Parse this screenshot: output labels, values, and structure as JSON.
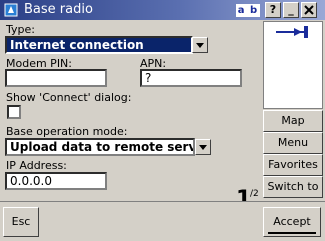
{
  "window": {
    "title": "Base radio",
    "input_mode": "a b",
    "help_label": "?",
    "minimize_label": "_",
    "close_label": "X"
  },
  "form": {
    "type_label": "Type:",
    "type_value": "Internet connection",
    "modem_pin_label": "Modem PIN:",
    "modem_pin_value": "",
    "apn_label": "APN:",
    "apn_value": "?",
    "show_connect_label": "Show 'Connect' dialog:",
    "show_connect_checked": false,
    "base_mode_label": "Base operation mode:",
    "base_mode_value": "Upload data to remote server",
    "ip_label": "IP Address:",
    "ip_value": "0.0.0.0"
  },
  "pager": {
    "current": "1",
    "total": "/2"
  },
  "sidebar": {
    "status_icon": "antenna-connection-icon",
    "buttons": [
      "Map",
      "Menu",
      "Favorites",
      "Switch to"
    ]
  },
  "bottom": {
    "esc_label": "Esc",
    "accept_label": "Accept"
  },
  "colors": {
    "title_bar": "#2b3f86",
    "selection": "#0a246a",
    "face": "#d4d0c8",
    "icon_blue": "#1a2c9b"
  }
}
